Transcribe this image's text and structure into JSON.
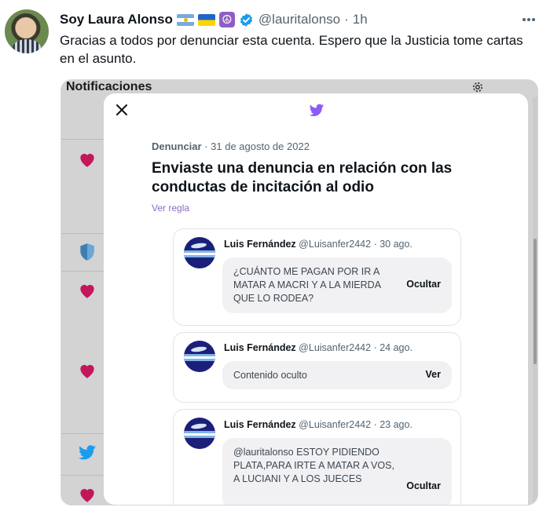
{
  "tweet": {
    "display_name": "Soy Laura Alonso",
    "handle": "@lauritalonso",
    "separator": "·",
    "time": "1h",
    "text": "Gracias a todos por denunciar esta cuenta. Espero que la Justicia tome cartas en el asunto.",
    "name_emojis": [
      "argentina-flag-icon",
      "ukraine-flag-icon",
      "peace-symbol-icon",
      "verified-badge-icon"
    ],
    "peace_glyph": "☮"
  },
  "colors": {
    "verified_blue": "#1d9bf0",
    "twitter_purple": "#8b5cf6",
    "heart_red": "#c2185b",
    "link_purple": "#8b6bc4"
  },
  "screenshot": {
    "background_title": "Notificaciones",
    "background_icons": [
      "heart-icon",
      "shield-icon",
      "heart-icon",
      "heart-icon",
      "twitter-bird-icon",
      "heart-icon"
    ],
    "modal": {
      "report_label": "Denunciar",
      "report_date": "· 31 de agosto de 2022",
      "title": "Enviaste una denuncia en relación con las conductas de incitación al odio",
      "rule_link": "Ver regla",
      "reported_tweets": [
        {
          "name": "Luis Fernández",
          "handle": "@Luisanfer2442",
          "date": "· 30 ago.",
          "content": "¿CUÁNTO ME PAGAN POR IR A MATAR A MACRI Y A LA MIERDA QUE LO RODEA?",
          "action": "Ocultar"
        },
        {
          "name": "Luis Fernández",
          "handle": "@Luisanfer2442",
          "date": "· 24 ago.",
          "content": "Contenido oculto",
          "action": "Ver"
        },
        {
          "name": "Luis Fernández",
          "handle": "@Luisanfer2442",
          "date": "· 23 ago.",
          "content": "@lauritalonso ESTOY PIDIENDO PLATA,PARA IRTE A MATAR A VOS, A LUCIANI Y A LOS JUECES",
          "action": "Ocultar"
        }
      ]
    }
  }
}
